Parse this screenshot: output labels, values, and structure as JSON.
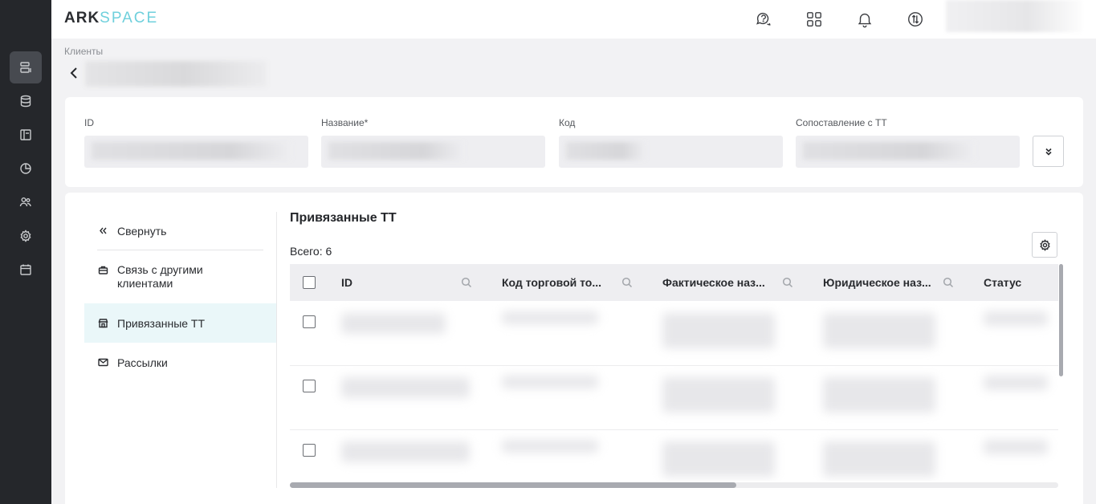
{
  "app": {
    "logo_ark": "ARK",
    "logo_space": "SPACE"
  },
  "sidebar": {
    "items": [
      {
        "icon": "clients-icon",
        "active": true
      },
      {
        "icon": "database-icon",
        "active": false
      },
      {
        "icon": "layout-icon",
        "active": false
      },
      {
        "icon": "chart-icon",
        "active": false
      },
      {
        "icon": "users-icon",
        "active": false
      },
      {
        "icon": "gear-icon",
        "active": false
      },
      {
        "icon": "calendar-icon",
        "active": false
      }
    ]
  },
  "topbar": {
    "icons": [
      "support-chat-icon",
      "apps-grid-icon",
      "bell-icon",
      "sync-icon"
    ]
  },
  "breadcrumb": "Клиенты",
  "fields": {
    "id_label": "ID",
    "name_label": "Название*",
    "code_label": "Код",
    "mapping_label": "Сопоставление с ТТ"
  },
  "nav": {
    "collapse": "Свернуть",
    "links_line1": "Связь с другими",
    "links_line2": "клиентами",
    "bound_tt": "Привязанные ТТ",
    "mailings": "Рассылки"
  },
  "section": {
    "title": "Привязанные ТТ",
    "total": "Всего: 6"
  },
  "table": {
    "columns": [
      "ID",
      "Код торговой то...",
      "Фактическое наз...",
      "Юридическое наз...",
      "Статус"
    ]
  }
}
